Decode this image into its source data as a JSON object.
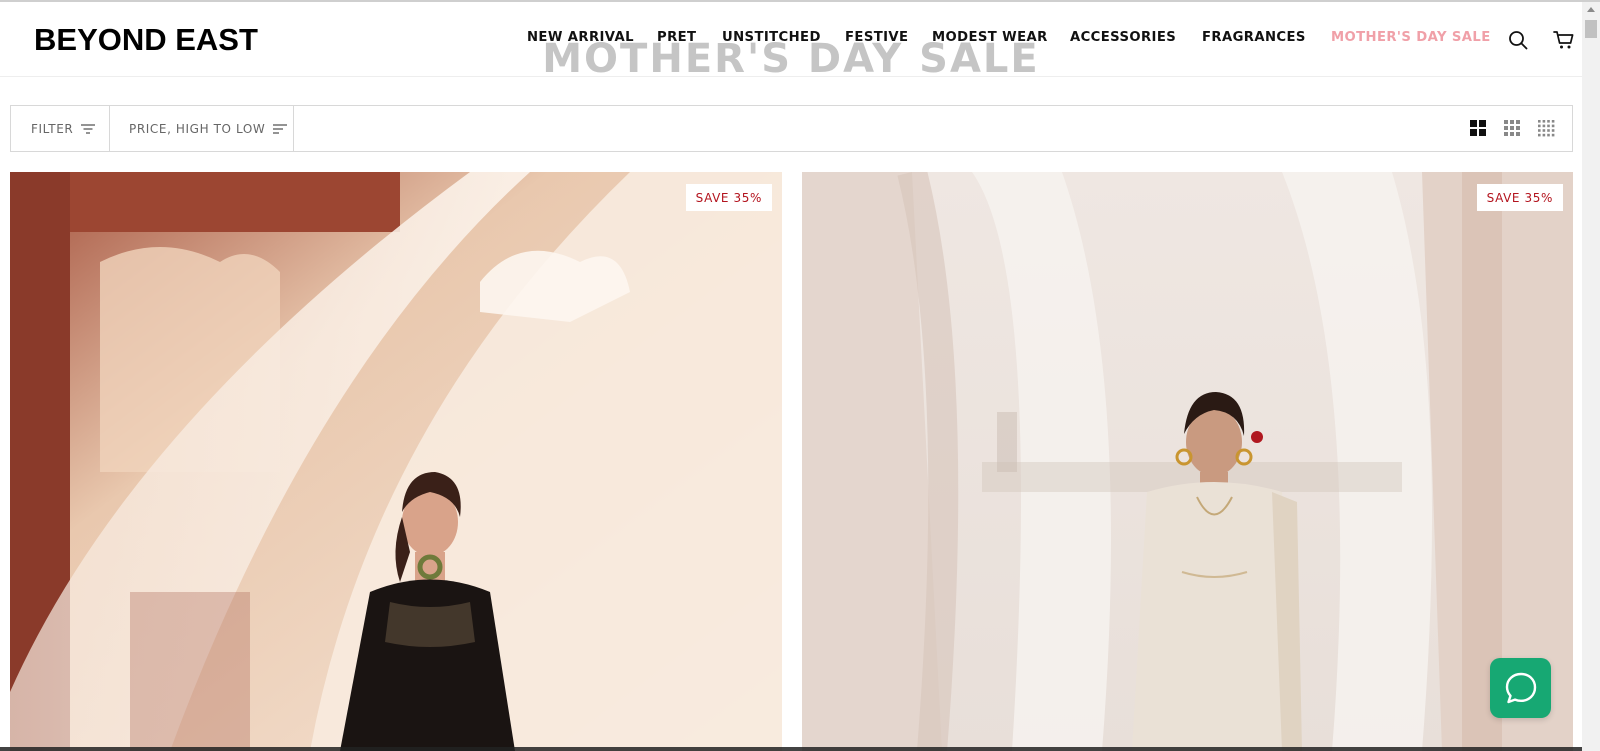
{
  "brand": {
    "logo_text": "BEYOND EAST"
  },
  "nav": {
    "items": [
      {
        "label": "NEW ARRIVAL"
      },
      {
        "label": "PRET"
      },
      {
        "label": "UNSTITCHED"
      },
      {
        "label": "FESTIVE"
      },
      {
        "label": "MODEST WEAR"
      },
      {
        "label": "ACCESSORIES"
      },
      {
        "label": "FRAGRANCES"
      },
      {
        "label": "MOTHER'S DAY SALE",
        "highlight_color": "#f0a0a8"
      }
    ],
    "icons": {
      "search": "search-icon",
      "cart": "cart-icon"
    }
  },
  "page": {
    "title": "MOTHER'S DAY SALE"
  },
  "toolbar": {
    "filter_label": "FILTER",
    "sort_label": "PRICE, HIGH TO LOW",
    "view_icons": [
      "grid-2-icon",
      "grid-3-icon",
      "grid-4-icon"
    ]
  },
  "products": [
    {
      "badge": "SAVE 35%"
    },
    {
      "badge": "SAVE 35%"
    }
  ],
  "colors": {
    "badge_text": "#b3141e",
    "chat_button": "#17a873",
    "sale_nav": "#f0a0a8",
    "title_text": "#c5c5c5"
  },
  "chat": {
    "icon": "chat-bubble-icon"
  }
}
